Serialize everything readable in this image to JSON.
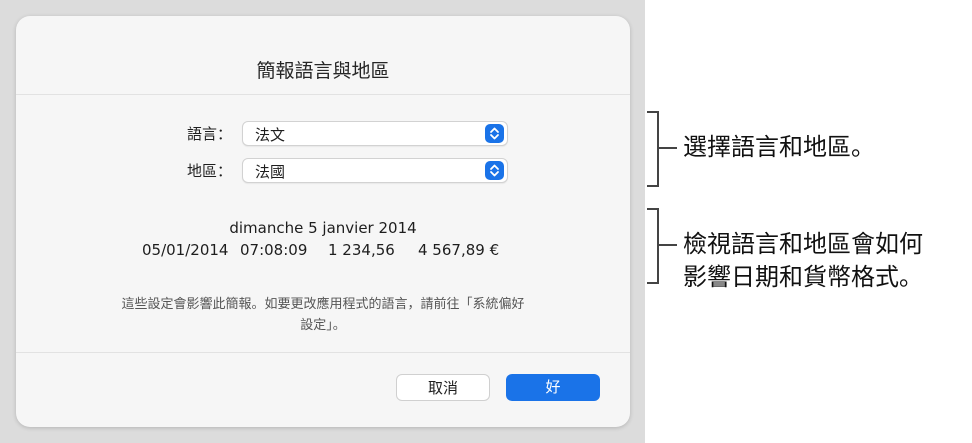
{
  "dialog": {
    "title": "簡報語言與地區",
    "language_label": "語言：",
    "language_value": "法文",
    "region_label": "地區：",
    "region_value": "法國",
    "preview_date": "dimanche 5 janvier 2014",
    "preview_short_date": "05/01/2014",
    "preview_time": "07:08:09",
    "preview_number": "1 234,56",
    "preview_currency": "4 567,89 €",
    "note_line1": "這些設定會影響此簡報。如要更改應用程式的語言，請前往「系統偏好",
    "note_line2": "設定」。",
    "cancel_label": "取消",
    "ok_label": "好"
  },
  "callouts": {
    "first": "選擇語言和地區。",
    "second_line1": "檢視語言和地區會如何",
    "second_line2": "影響日期和貨幣格式。"
  },
  "colors": {
    "accent": "#1a73e8",
    "backdrop": "#dcdcdc",
    "dialog_bg": "#f6f6f6"
  }
}
